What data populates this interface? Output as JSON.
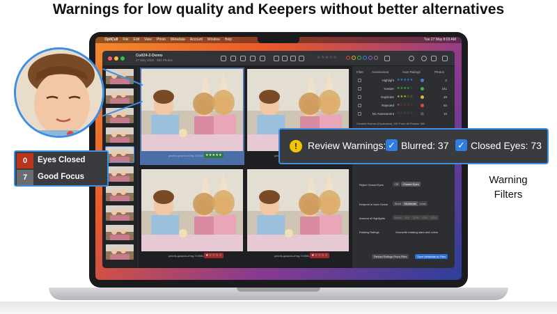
{
  "headline": "Warnings for low quality and Keepers without better alternatives",
  "menubar": {
    "items": [
      "OptiCull",
      "File",
      "Edit",
      "View",
      "Photo",
      "Metadata",
      "Account",
      "Window",
      "Help"
    ],
    "clock": "Tue 27 May 8:03 AM"
  },
  "window": {
    "title": "Cull24-2-Demo",
    "subtitle": "27 May 2023 · 381 Photos"
  },
  "filmstrip_count": 10,
  "grid": {
    "cells": [
      {
        "filename": "pexels-gustavo-fring-7100814-0001.dng",
        "rating": "★★★★★",
        "rating_color": "#2f7a3a",
        "selected": true
      },
      {
        "filename": "pexels-gustavo-fring-7100814-0002.dng",
        "rating": "★★★★★",
        "rating_color": "#2f7a3a",
        "selected": false
      },
      {
        "filename": "pexels-gustavo-fring-7100814-0002.dng",
        "rating": "★☆☆☆☆",
        "rating_color": "#9a2a2a",
        "selected": false
      },
      {
        "filename": "pexels-gustavo-fring-7100814-0003.dng",
        "rating": "★☆☆☆☆",
        "rating_color": "#9a2a2a",
        "selected": false
      }
    ]
  },
  "panel": {
    "headers": {
      "filter": "Filter",
      "assessment": "Assessment",
      "auto": "Auto Ratings",
      "photos": "Photos"
    },
    "rows": [
      {
        "label": "Highlight",
        "stars": "★★★★★",
        "star_color": "#3b82e0",
        "dot": "#3b82e0",
        "count": "0"
      },
      {
        "label": "Keeper",
        "stars": "★★★★☆",
        "star_color": "#3fb24f",
        "dot": "#3fb24f",
        "count": "241"
      },
      {
        "label": "Duplicate",
        "stars": "★★★☆☆",
        "star_color": "#e0b63b",
        "dot": "#e0b63b",
        "count": "49"
      },
      {
        "label": "Rejected",
        "stars": "★☆☆☆☆",
        "star_color": "#e04a3b",
        "dot": "#e04a3b",
        "count": "84"
      },
      {
        "label": "No Assessment",
        "stars": "☆☆☆☆☆",
        "star_color": "#777777",
        "dot": "#555555",
        "count": "15"
      }
    ],
    "summary": "Created Scenes (Duplicates): 257   From All Photos: 390",
    "reject_closed_eyes_label": "Reject Closed Eyes",
    "reject_options": [
      "Off",
      "Closed Eyes"
    ],
    "keepers_label": "Keepers in each Scene",
    "keepers_options": [
      "More",
      "Moderate",
      "Less"
    ],
    "highlights_label": "Amount of Highlights",
    "highlights_options": [
      "None",
      "5%",
      "10%",
      "15%",
      "20%"
    ],
    "existing_label": "Existing Ratings",
    "existing_value": "Overwrite existing stars and colors",
    "btn_reload": "Reload Ratings From Files",
    "btn_save": "Save Metadata to Files"
  },
  "legend": [
    {
      "count": "0",
      "label": "Eyes Closed",
      "color": "#b8341b"
    },
    {
      "count": "7",
      "label": "Good Focus",
      "color": "#6b6c70"
    }
  ],
  "warnings": {
    "title": "Review Warnings:",
    "blurred": "Blurred: 37",
    "closed": "Closed Eyes: 73"
  },
  "side_note": [
    "Warning",
    "Filters"
  ]
}
